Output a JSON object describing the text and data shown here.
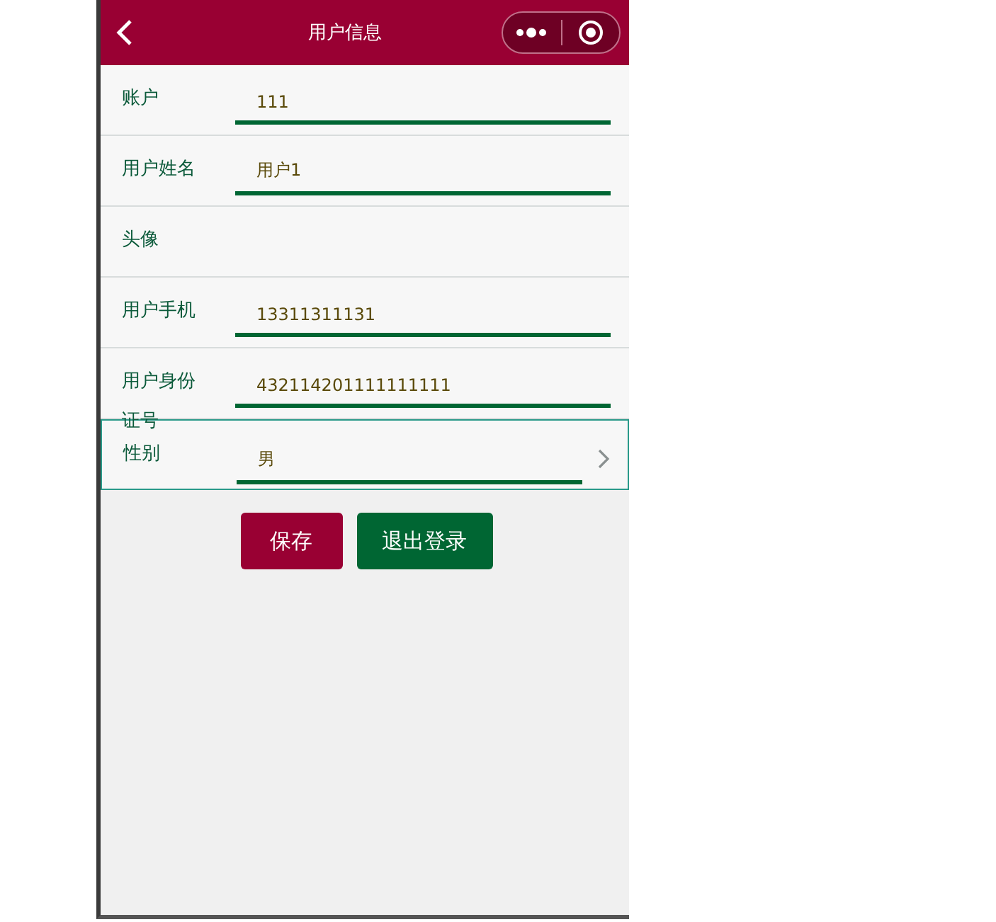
{
  "header": {
    "title": "用户信息"
  },
  "fields": [
    {
      "kind": "input",
      "label": "账户",
      "value": "111"
    },
    {
      "kind": "input",
      "label": "用户姓名",
      "value": "用户1"
    },
    {
      "kind": "avatar",
      "label": "头像"
    },
    {
      "kind": "input",
      "label": "用户手机",
      "value": "13311311131"
    },
    {
      "kind": "input",
      "label": "用户身份证号",
      "value": "432114201111111111"
    },
    {
      "kind": "select",
      "label": "性别",
      "value": "男"
    }
  ],
  "buttons": [
    {
      "kind": "primary",
      "label": "保存"
    },
    {
      "kind": "secondary",
      "label": "退出登录"
    }
  ]
}
